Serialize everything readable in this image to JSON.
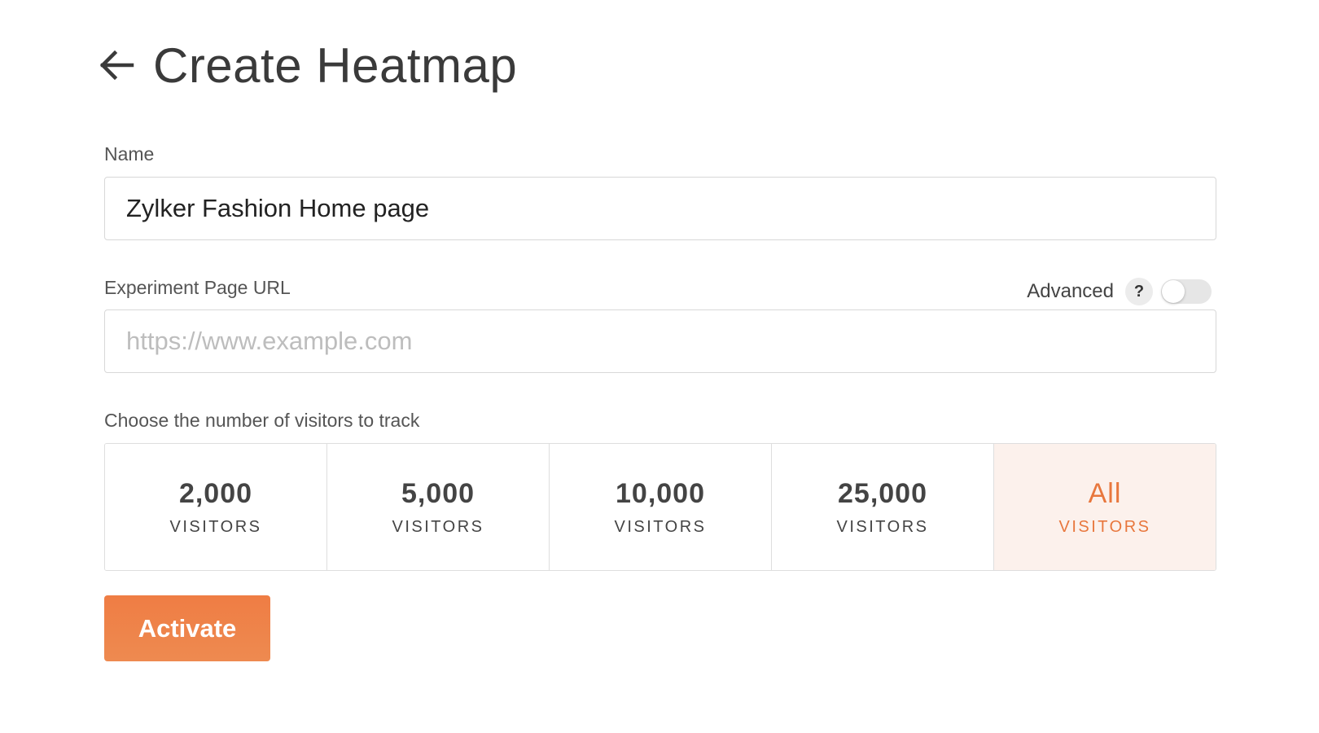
{
  "header": {
    "title": "Create Heatmap",
    "back_icon": "arrow-left-icon"
  },
  "form": {
    "name_label": "Name",
    "name_value": "Zylker Fashion Home page",
    "url_label": "Experiment Page URL",
    "url_placeholder": "https://www.example.com",
    "url_value": "",
    "advanced_label": "Advanced",
    "help_symbol": "?",
    "advanced_toggle_on": false,
    "visitors_label": "Choose the number of visitors to track",
    "visitor_options": [
      {
        "value": "2,000",
        "unit": "VISITORS",
        "selected": false
      },
      {
        "value": "5,000",
        "unit": "VISITORS",
        "selected": false
      },
      {
        "value": "10,000",
        "unit": "VISITORS",
        "selected": false
      },
      {
        "value": "25,000",
        "unit": "VISITORS",
        "selected": false
      },
      {
        "value": "All",
        "unit": "VISITORS",
        "selected": true
      }
    ],
    "activate_label": "Activate"
  },
  "colors": {
    "accent": "#e8773d",
    "selected_bg": "#fcf1ec"
  }
}
